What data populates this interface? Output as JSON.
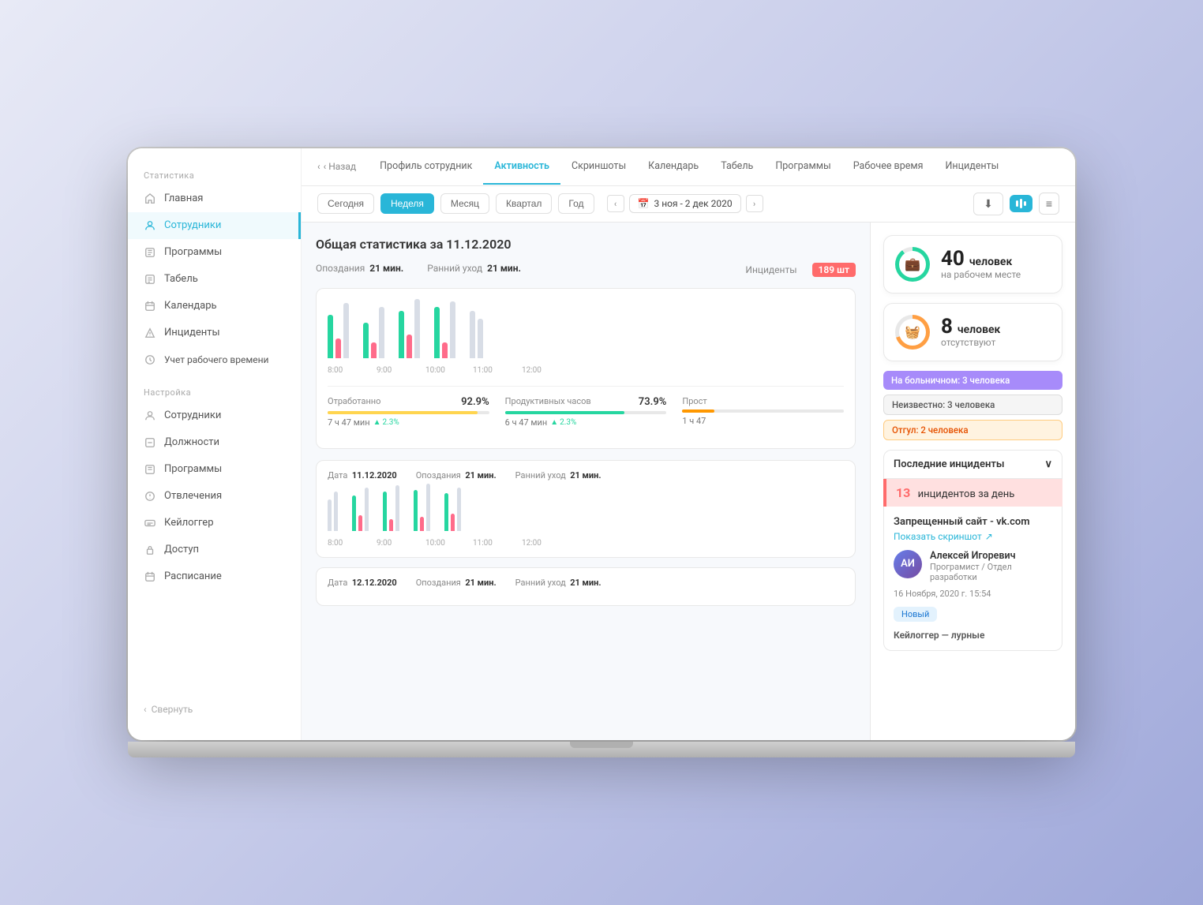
{
  "sidebar": {
    "statistics_label": "Статистика",
    "settings_label": "Настройка",
    "items_statistics": [
      {
        "id": "home",
        "label": "Главная",
        "active": false
      },
      {
        "id": "employees",
        "label": "Сотрудники",
        "active": true
      },
      {
        "id": "programs",
        "label": "Программы",
        "active": false
      },
      {
        "id": "tabel",
        "label": "Табель",
        "active": false
      },
      {
        "id": "calendar",
        "label": "Календарь",
        "active": false
      },
      {
        "id": "incidents",
        "label": "Инциденты",
        "active": false
      },
      {
        "id": "worktime",
        "label": "Учет рабочего\nвремени",
        "active": false
      }
    ],
    "items_settings": [
      {
        "id": "employees2",
        "label": "Сотрудники"
      },
      {
        "id": "positions",
        "label": "Должности"
      },
      {
        "id": "programs2",
        "label": "Программы"
      },
      {
        "id": "distractions",
        "label": "Отвлечения"
      },
      {
        "id": "keylogger",
        "label": "Кейлоггер"
      },
      {
        "id": "access",
        "label": "Доступ"
      },
      {
        "id": "schedule",
        "label": "Расписание"
      }
    ],
    "collapse_label": "Свернуть"
  },
  "tabs": [
    {
      "id": "back",
      "label": "‹ Назад"
    },
    {
      "id": "profile",
      "label": "Профиль сотрудник"
    },
    {
      "id": "activity",
      "label": "Активность",
      "active": true
    },
    {
      "id": "screenshots",
      "label": "Скриншоты"
    },
    {
      "id": "calendar",
      "label": "Календарь"
    },
    {
      "id": "tabel",
      "label": "Табель"
    },
    {
      "id": "programs",
      "label": "Программы"
    },
    {
      "id": "worktime",
      "label": "Рабочее время"
    },
    {
      "id": "incidents",
      "label": "Инциденты"
    }
  ],
  "toolbar": {
    "periods": [
      "Сегодня",
      "Неделя",
      "Месяц",
      "Квартал",
      "Год"
    ],
    "active_period": "Неделя",
    "date_range": "3 ноя - 2 дек 2020"
  },
  "main": {
    "stats_title": "Общая статистика за 11.12.2020",
    "summary": {
      "late_label": "Опоздания",
      "late_value": "21 мин.",
      "early_label": "Ранний уход",
      "early_value": "21 мин.",
      "incidents_label": "Инциденты",
      "incidents_value": "189 шт"
    },
    "metrics": [
      {
        "label": "Отработанно",
        "pct": "92.9%",
        "bar_pct": 93,
        "color": "yellow",
        "value": "7 ч 47 мин",
        "change": "2.3%"
      },
      {
        "label": "Продуктивных часов",
        "pct": "73.9%",
        "bar_pct": 74,
        "color": "teal",
        "value": "6 ч 47 мин",
        "change": "2.3%"
      },
      {
        "label": "Прост",
        "pct": "",
        "bar_pct": 20,
        "color": "orange",
        "value": "1 ч 47",
        "change": ""
      }
    ],
    "day_rows": [
      {
        "date_label": "Дата",
        "date_value": "11.12.2020",
        "late_label": "Опоздания",
        "late_value": "21 мин.",
        "early_label": "Ранний уход",
        "early_value": "21 мин."
      },
      {
        "date_label": "Дата",
        "date_value": "12.12.2020",
        "late_label": "Опоздания",
        "late_value": "21 мин.",
        "early_label": "Ранний уход",
        "early_value": "21 мин."
      }
    ]
  },
  "right_panel": {
    "present": {
      "count": "40",
      "label": "на рабочем месте",
      "pct": 90
    },
    "absent": {
      "count": "8",
      "label": "отсутствуют",
      "pct": 70
    },
    "status_tags": [
      {
        "label": "На больничном: 3 человека",
        "type": "purple"
      },
      {
        "label": "Неизвестно: 3 человека",
        "type": "gray-border"
      },
      {
        "label": "Отгул: 2 человека",
        "type": "orange"
      }
    ],
    "incidents_header": "Последние инциденты",
    "incidents_day_count": "13",
    "incidents_day_label": "инцидентов за день",
    "incident_site": "Запрещенный сайт - vk.com",
    "screenshot_label": "Показать скриншот",
    "user": {
      "name": "Алексей Игоревич",
      "role": "Програмист / Отдел разработки",
      "time": "16 Ноября, 2020 г. 15:54"
    },
    "new_badge": "Новый",
    "next_incident": "Кейлоггер — лурные"
  }
}
